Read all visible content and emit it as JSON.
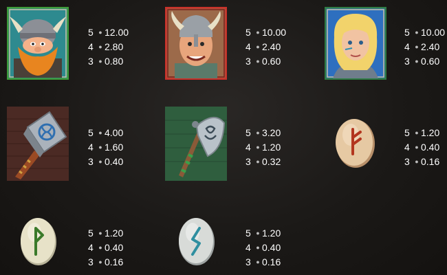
{
  "paytable": [
    {
      "symbol": "viking-chief-icon",
      "frame": "#3f9b3a",
      "pays": [
        {
          "count": "5",
          "value": "12.00"
        },
        {
          "count": "4",
          "value": "2.80"
        },
        {
          "count": "3",
          "value": "0.80"
        }
      ]
    },
    {
      "symbol": "viking-warrior-icon",
      "frame": "#c9312a",
      "pays": [
        {
          "count": "5",
          "value": "10.00"
        },
        {
          "count": "4",
          "value": "2.40"
        },
        {
          "count": "3",
          "value": "0.60"
        }
      ]
    },
    {
      "symbol": "shieldmaiden-icon",
      "frame": "#2f7c45",
      "pays": [
        {
          "count": "5",
          "value": "10.00"
        },
        {
          "count": "4",
          "value": "2.40"
        },
        {
          "count": "3",
          "value": "0.60"
        }
      ]
    },
    {
      "symbol": "hammer-icon",
      "frame": "#4b2a24",
      "pays": [
        {
          "count": "5",
          "value": "4.00"
        },
        {
          "count": "4",
          "value": "1.60"
        },
        {
          "count": "3",
          "value": "0.40"
        }
      ]
    },
    {
      "symbol": "axe-icon",
      "frame": "#2f5e3e",
      "pays": [
        {
          "count": "5",
          "value": "3.20"
        },
        {
          "count": "4",
          "value": "1.20"
        },
        {
          "count": "3",
          "value": "0.32"
        }
      ]
    },
    {
      "symbol": "rune-fehu-icon",
      "frame": "#e6c9a3",
      "pays": [
        {
          "count": "5",
          "value": "1.20"
        },
        {
          "count": "4",
          "value": "0.40"
        },
        {
          "count": "3",
          "value": "0.16"
        }
      ]
    },
    {
      "symbol": "rune-wunjo-icon",
      "frame": "#e7e2c8",
      "pays": [
        {
          "count": "5",
          "value": "1.20"
        },
        {
          "count": "4",
          "value": "0.40"
        },
        {
          "count": "3",
          "value": "0.16"
        }
      ]
    },
    {
      "symbol": "rune-sowilo-icon",
      "frame": "#d8dbd8",
      "pays": [
        {
          "count": "5",
          "value": "1.20"
        },
        {
          "count": "4",
          "value": "0.40"
        },
        {
          "count": "3",
          "value": "0.16"
        }
      ]
    }
  ]
}
